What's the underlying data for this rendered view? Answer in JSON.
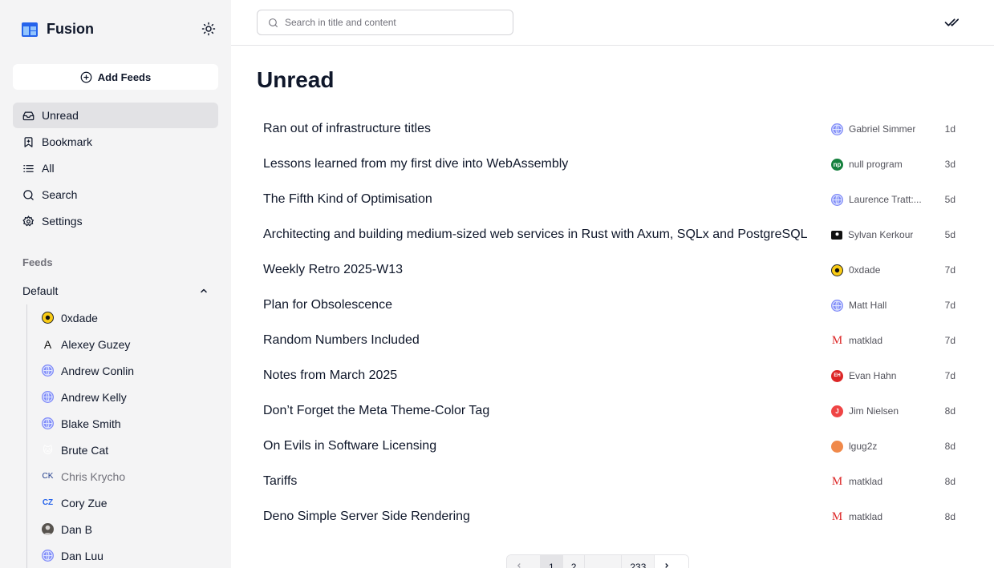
{
  "app": {
    "name": "Fusion"
  },
  "sidebar": {
    "add_feeds_label": "Add Feeds",
    "nav": [
      {
        "label": "Unread",
        "icon": "inbox-icon",
        "active": true
      },
      {
        "label": "Bookmark",
        "icon": "bookmark-icon"
      },
      {
        "label": "All",
        "icon": "list-icon"
      },
      {
        "label": "Search",
        "icon": "search-icon"
      },
      {
        "label": "Settings",
        "icon": "gear-icon"
      }
    ],
    "feeds_header": "Feeds",
    "group": {
      "label": "Default",
      "expanded": true
    },
    "feeds": [
      {
        "label": "0xdade",
        "icon": "0xdade-favicon"
      },
      {
        "label": "Alexey Guzey",
        "icon": "letter-a-favicon"
      },
      {
        "label": "Andrew Conlin",
        "icon": "globe-icon"
      },
      {
        "label": "Andrew Kelly",
        "icon": "globe-icon"
      },
      {
        "label": "Blake Smith",
        "icon": "globe-icon"
      },
      {
        "label": "Brute Cat",
        "icon": "cat-favicon"
      },
      {
        "label": "Chris Krycho",
        "icon": "ck-favicon"
      },
      {
        "label": "Cory Zue",
        "icon": "cz-favicon"
      },
      {
        "label": "Dan B",
        "icon": "avatar-favicon"
      },
      {
        "label": "Dan Luu",
        "icon": "globe-icon"
      }
    ]
  },
  "topbar": {
    "search_placeholder": "Search in title and content",
    "mark_all_read_icon": "double-check-icon"
  },
  "main": {
    "title": "Unread",
    "items": [
      {
        "title": "Ran out of infrastructure titles",
        "feed": "Gabriel Simmer",
        "age": "1d"
      },
      {
        "title": "Lessons learned from my first dive into WebAssembly",
        "feed": "null program",
        "age": "3d"
      },
      {
        "title": "The Fifth Kind of Optimisation",
        "feed": "Laurence Tratt:...",
        "age": "5d"
      },
      {
        "title": "Architecting and building medium-sized web services in Rust with Axum, SQLx and PostgreSQL",
        "feed": "Sylvan Kerkour",
        "age": "5d"
      },
      {
        "title": "Weekly Retro 2025-W13",
        "feed": "0xdade",
        "age": "7d"
      },
      {
        "title": "Plan for Obsolescence",
        "feed": "Matt Hall",
        "age": "7d"
      },
      {
        "title": "Random Numbers Included",
        "feed": "matklad",
        "age": "7d"
      },
      {
        "title": "Notes from March 2025",
        "feed": "Evan Hahn",
        "age": "7d"
      },
      {
        "title": "Don’t Forget the Meta Theme-Color Tag",
        "feed": "Jim Nielsen",
        "age": "8d"
      },
      {
        "title": "On Evils in Software Licensing",
        "feed": "lgug2z",
        "age": "8d"
      },
      {
        "title": "Tariffs",
        "feed": "matklad",
        "age": "8d"
      },
      {
        "title": "Deno Simple Server Side Rendering",
        "feed": "matklad",
        "age": "8d"
      }
    ]
  },
  "pagination": {
    "pages": [
      "1",
      "2",
      "...",
      "233"
    ],
    "current": "1"
  },
  "colors": {
    "sidebar_bg": "#f4f4f5",
    "active_nav": "#e2e2e5",
    "brand_blue": "#2563eb"
  }
}
